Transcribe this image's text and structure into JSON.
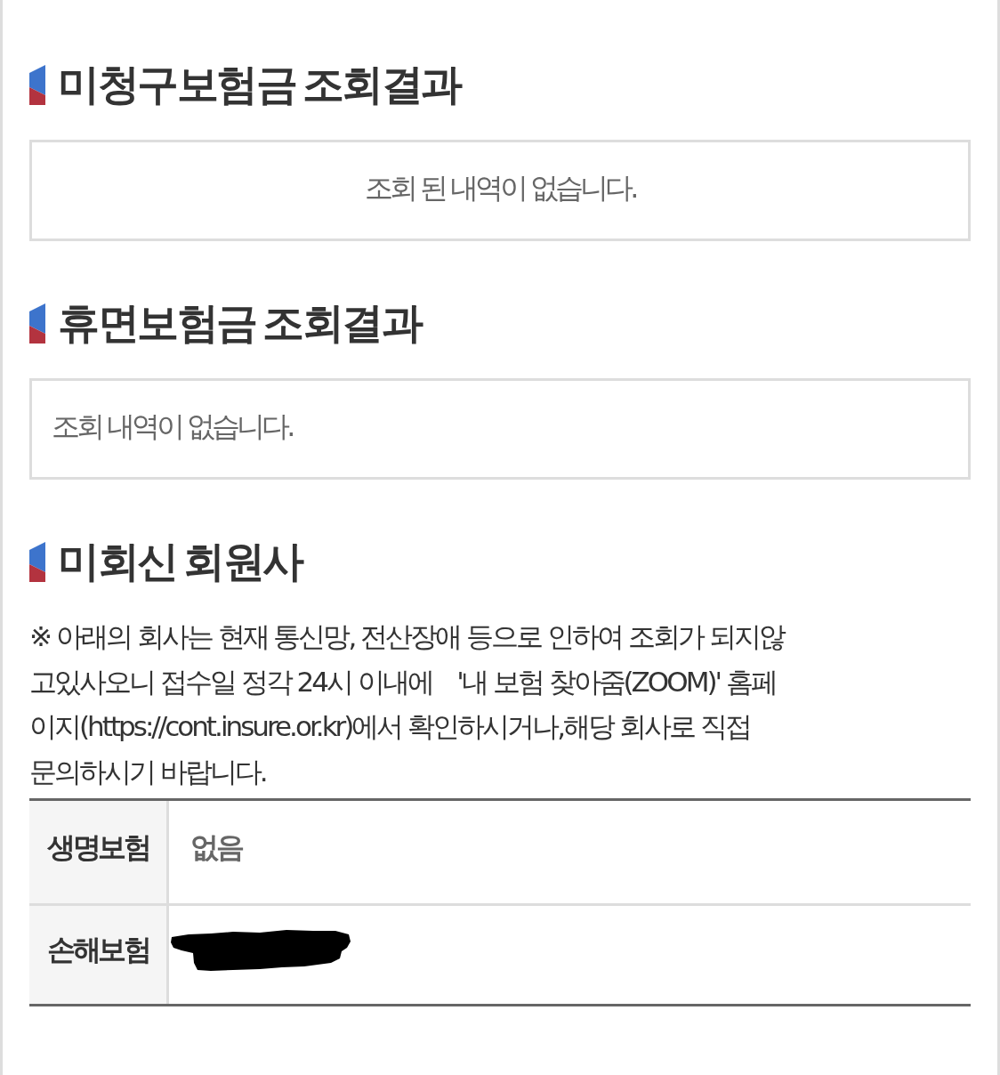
{
  "unclaimed_insurance": {
    "title": "미청구보험금 조회결과",
    "message": "조회 된 내역이 없습니다."
  },
  "dormant_insurance": {
    "title": "휴면보험금 조회결과",
    "message": "조회 내역이 없습니다."
  },
  "non_responding_members": {
    "title": "미회신 회원사",
    "note": "※ 아래의 회사는 현재 통신망, 전산장애 등으로 인하여 조회가 되지않\n고있사오니 접수일 정각 24시 이내에    '내 보험 찾아줌(ZOOM)' 홈페\n이지(https://cont.insure.or.kr)에서 확인하시거나,해당 회사로 직접\n문의하시기 바랍니다.",
    "rows": [
      {
        "label": "생명보험",
        "value": "없음",
        "redacted": false
      },
      {
        "label": "손해보험",
        "redacted": true
      }
    ]
  }
}
